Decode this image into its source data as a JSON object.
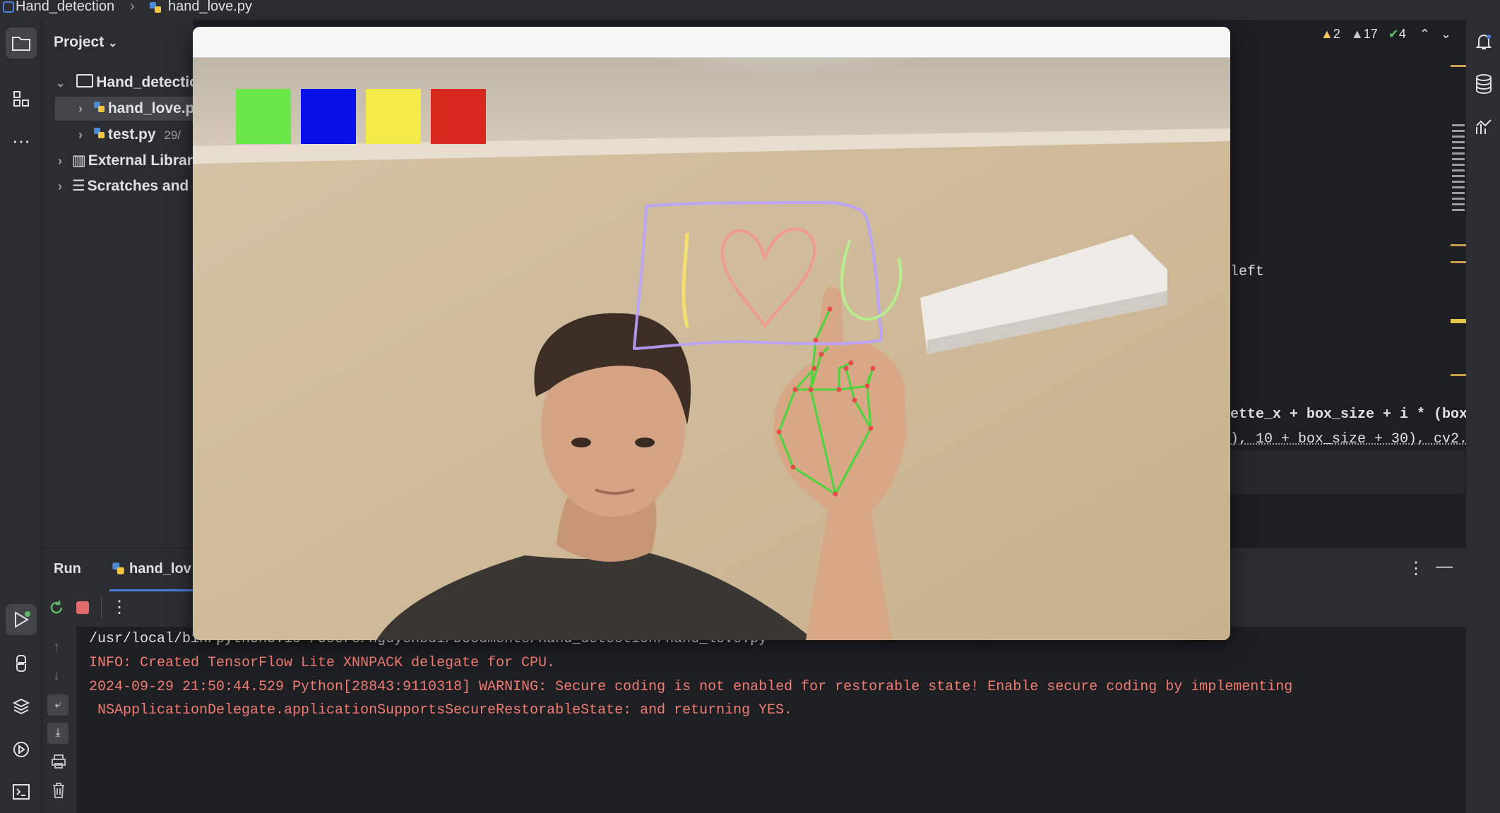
{
  "breadcrumb": {
    "project": "Hand_detection",
    "file": "hand_love.py"
  },
  "project_panel": {
    "title": "Project",
    "items": [
      {
        "label": "Hand_detectio",
        "type": "folder"
      },
      {
        "label": "hand_love.p",
        "type": "python"
      },
      {
        "label": "test.py",
        "meta": "29/",
        "type": "python"
      },
      {
        "label": "External Librar",
        "type": "library"
      },
      {
        "label": "Scratches and",
        "type": "scratch"
      }
    ]
  },
  "inspections": {
    "warnings": "2",
    "weak_warnings": "17",
    "ok": "4"
  },
  "editor_fragments": {
    "line1": "left",
    "line2": "ette_x + box_size + i * (box",
    "line3": "), 10 + box_size + 30), cv2."
  },
  "run_panel": {
    "tab_run": "Run",
    "tab_file": "hand_lov"
  },
  "console": {
    "lines": [
      "/usr/local/bin/python3.10 /Users/nguyenbui/Documents/Hand_detection/hand_love.py",
      "INFO: Created TensorFlow Lite XNNPACK delegate for CPU.",
      "2024-09-29 21:50:44.529 Python[28843:9110318] WARNING: Secure coding is not enabled for restorable state! Enable secure coding by implementing",
      " NSApplicationDelegate.applicationSupportsSecureRestorableState: and returning YES."
    ]
  },
  "palette": {
    "colors": [
      "#6ae84a",
      "#0710e6",
      "#f4ea48",
      "#d9281d"
    ]
  },
  "drawing": {
    "text": "I ♥ U",
    "stroke_colors": {
      "box": "#b9a2ff",
      "i": "#f3df70",
      "heart": "#f09a8e",
      "u": "#b6ee8d"
    }
  }
}
